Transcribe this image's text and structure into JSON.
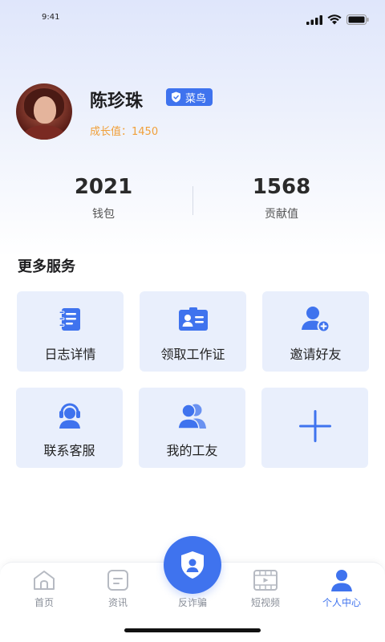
{
  "status_bar": {
    "time": "9:41"
  },
  "profile": {
    "name": "陈珍珠",
    "badge_label": "菜鸟",
    "growth_label": "成长值：1450"
  },
  "stats": [
    {
      "value": "2021",
      "label": "钱包"
    },
    {
      "value": "1568",
      "label": "贡献值"
    }
  ],
  "services": {
    "title": "更多服务",
    "items": [
      {
        "label": "日志详情",
        "icon": "notebook-icon"
      },
      {
        "label": "领取工作证",
        "icon": "id-card-icon"
      },
      {
        "label": "邀请好友",
        "icon": "add-user-icon"
      },
      {
        "label": "联系客服",
        "icon": "headset-icon"
      },
      {
        "label": "我的工友",
        "icon": "users-icon"
      },
      {
        "label": "",
        "icon": "plus-icon"
      }
    ]
  },
  "tabbar": {
    "tabs": [
      {
        "label": "首页",
        "icon": "home-icon"
      },
      {
        "label": "资讯",
        "icon": "news-icon"
      },
      {
        "label": "反诈骗",
        "icon": "shield-user-icon"
      },
      {
        "label": "短视频",
        "icon": "video-icon"
      },
      {
        "label": "个人中心",
        "icon": "person-icon"
      }
    ],
    "active_index": 4
  },
  "colors": {
    "accent": "#3f73ee",
    "growth": "#f0a03a",
    "card_bg": "#e9effc"
  }
}
